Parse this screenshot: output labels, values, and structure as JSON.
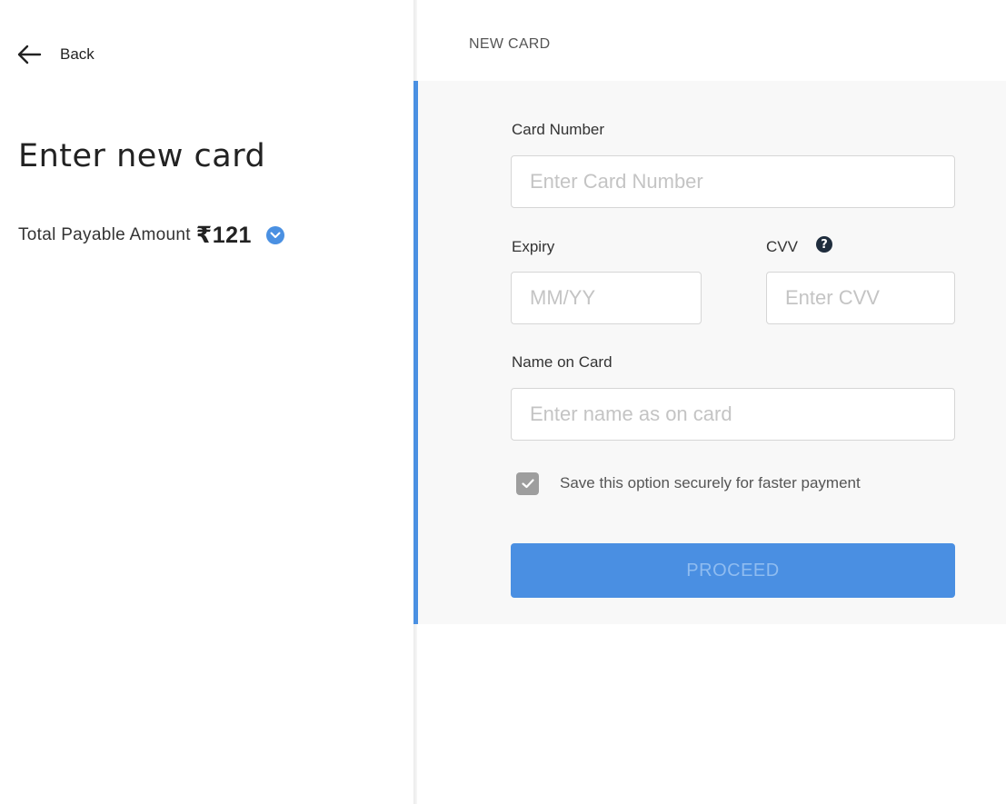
{
  "nav": {
    "back_label": "Back",
    "back_icon": "arrow-left-icon"
  },
  "summary": {
    "title": "Enter new card",
    "amount_label": "Total Payable Amount",
    "amount_value": "₹121",
    "info_icon": "chevron-down-circle-icon"
  },
  "form": {
    "header": "NEW CARD",
    "accent_color": "#4a90e2",
    "card_number": {
      "label": "Card Number",
      "placeholder": "Enter Card Number",
      "value": ""
    },
    "expiry": {
      "label": "Expiry",
      "placeholder": "MM/YY",
      "value": ""
    },
    "cvv": {
      "label": "CVV",
      "placeholder": "Enter CVV",
      "value": "",
      "help_icon": "question-circle-icon",
      "help_glyph": "?"
    },
    "name": {
      "label": "Name on Card",
      "placeholder": "Enter name as on card",
      "value": ""
    },
    "save_option": {
      "label": "Save this option securely for faster payment",
      "checked": true
    },
    "proceed_label": "PROCEED"
  }
}
